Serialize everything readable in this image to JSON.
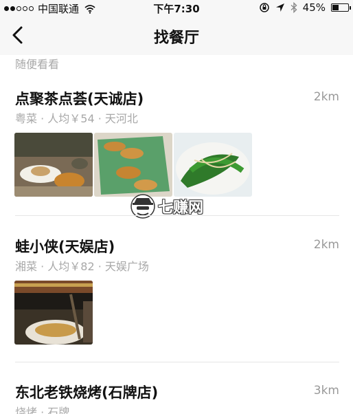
{
  "status_bar": {
    "carrier": "中国联通",
    "time": "下午7:30",
    "battery_text": "45%",
    "battery_level": 0.45,
    "icons": [
      "signal-icon",
      "wifi-icon",
      "lock-rotation-icon",
      "location-arrow-icon",
      "bluetooth-icon",
      "battery-icon"
    ]
  },
  "nav": {
    "title": "找餐厅",
    "back_icon": "chevron-left-icon"
  },
  "section_label": "随便看看",
  "restaurants": [
    {
      "name": "点聚茶点荟(天诚店)",
      "distance": "2km",
      "meta": "粤菜 · 人均￥54 · 天河北",
      "photos": [
        "dim-sum-dessert-photo",
        "fried-dumplings-photo",
        "green-vegetables-photo"
      ]
    },
    {
      "name": "蛙小侠(天娱店)",
      "distance": "2km",
      "meta": "湘菜 · 人均￥82 · 天娱广场",
      "photos": [
        "restaurant-table-photo"
      ]
    },
    {
      "name": "东北老铁烧烤(石牌店)",
      "distance": "3km",
      "meta": "烧烤 · 石牌",
      "photos": []
    }
  ],
  "watermark": {
    "text": "七赚网",
    "icon": "spy-avatar-icon"
  },
  "colors": {
    "background": "#ffffff",
    "bar_background": "#f7f7f7",
    "secondary_text": "#a8a8a8",
    "divider": "#e6e6e6"
  }
}
